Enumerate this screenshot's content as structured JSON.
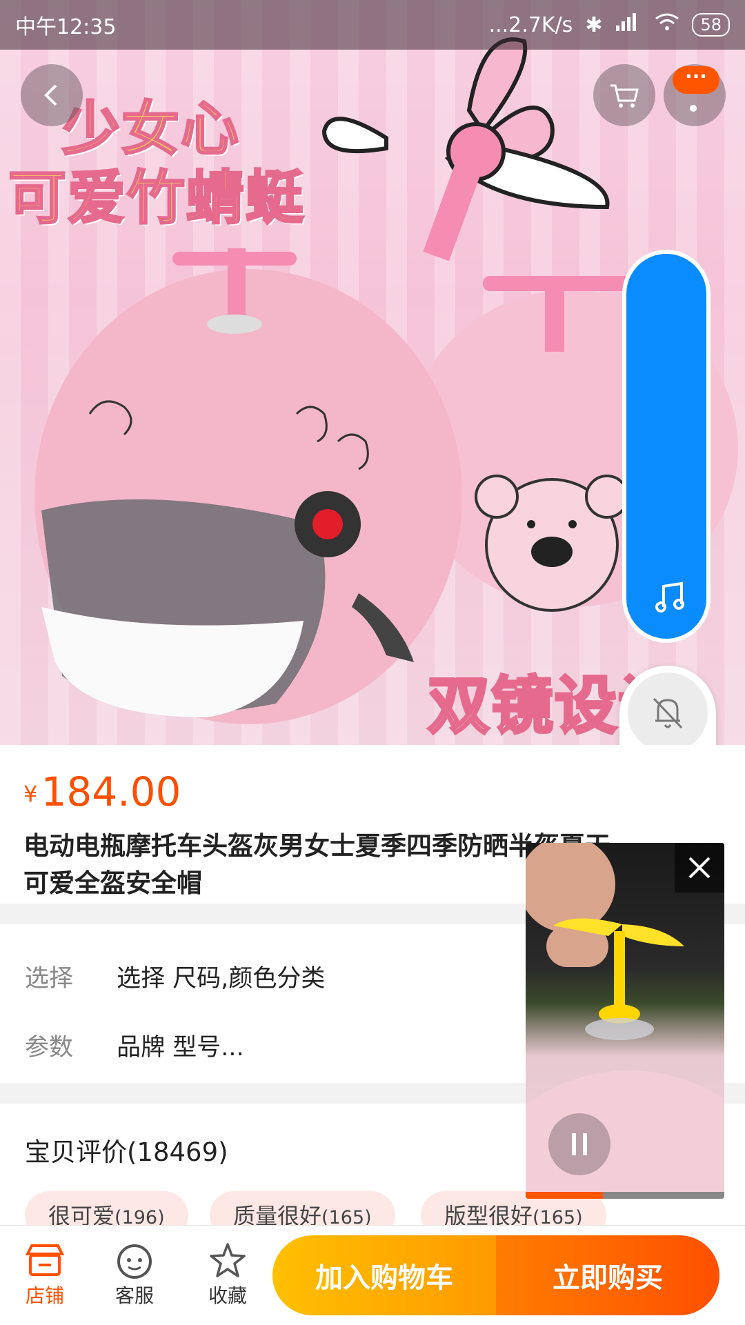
{
  "status_bar": {
    "time": "中午12:35",
    "network": "...2.7K/s",
    "battery": "58"
  },
  "hero": {
    "line1": "少女心",
    "line2": "可爱竹蜻蜓",
    "line3": "双镜设计"
  },
  "product": {
    "currency": "¥",
    "price": "184.00",
    "title": "电动电瓶摩托车头盔灰男女士夏季四季防晒半盔夏天可爱全盔安全帽"
  },
  "options": {
    "select_label": "选择",
    "select_value": "选择 尺码,颜色分类",
    "params_label": "参数",
    "params_value": "品牌 型号..."
  },
  "reviews": {
    "title": "宝贝评价(18469)",
    "tags": [
      {
        "label": "很可爱",
        "count": "(196)"
      },
      {
        "label": "质量很好",
        "count": "(165)"
      },
      {
        "label": "版型很好",
        "count": "(165)"
      }
    ]
  },
  "video": {
    "progress_fraction": 0.39
  },
  "bottom_bar": {
    "store": "店铺",
    "service": "客服",
    "favorite": "收藏",
    "add_to_cart": "加入购物车",
    "buy_now": "立即购买"
  },
  "icons": [
    "back-arrow-icon",
    "cart-icon",
    "more-icon",
    "music-note-icon",
    "bell-off-icon",
    "close-icon",
    "pause-icon",
    "store-icon",
    "service-icon",
    "star-icon"
  ]
}
